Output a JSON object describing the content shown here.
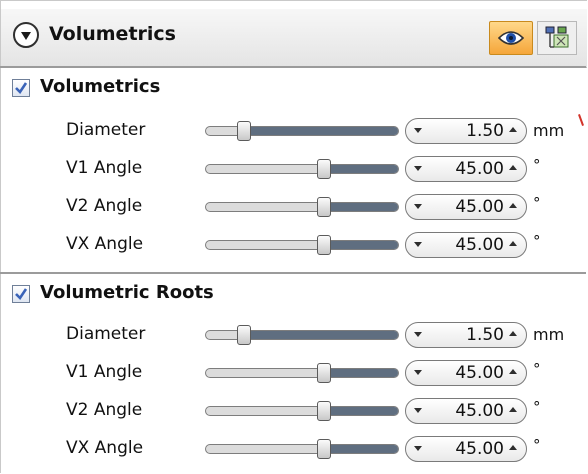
{
  "header": {
    "title": "Volumetrics",
    "eye_icon": "eye-icon",
    "tools_icon": "tools-icon"
  },
  "sections": [
    {
      "title": "Volumetrics",
      "checked": true,
      "rows": [
        {
          "label": "Diameter",
          "value": "1.50",
          "unit": "mm",
          "level": 0.18
        },
        {
          "label": "V1 Angle",
          "value": "45.00",
          "unit": "°",
          "level": 0.62
        },
        {
          "label": "V2 Angle",
          "value": "45.00",
          "unit": "°",
          "level": 0.62
        },
        {
          "label": "VX Angle",
          "value": "45.00",
          "unit": "°",
          "level": 0.62
        }
      ]
    },
    {
      "title": "Volumetric Roots",
      "checked": true,
      "rows": [
        {
          "label": "Diameter",
          "value": "1.50",
          "unit": "mm",
          "level": 0.18
        },
        {
          "label": "V1 Angle",
          "value": "45.00",
          "unit": "°",
          "level": 0.62
        },
        {
          "label": "V2 Angle",
          "value": "45.00",
          "unit": "°",
          "level": 0.62
        },
        {
          "label": "VX Angle",
          "value": "45.00",
          "unit": "°",
          "level": 0.62
        }
      ]
    }
  ],
  "colors": {
    "accent": "#f5a63a",
    "slider_fill": "#5f6e80",
    "check": "#3a63b8"
  }
}
